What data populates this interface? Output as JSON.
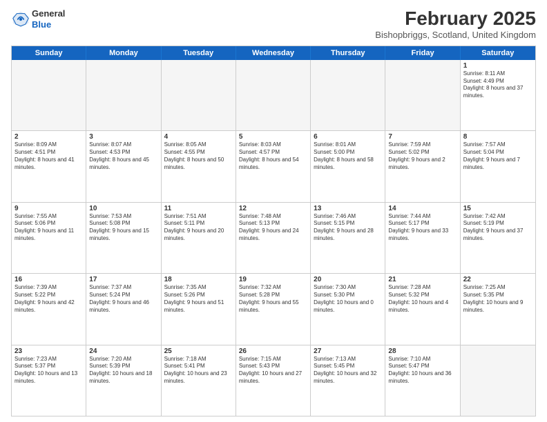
{
  "logo": {
    "general": "General",
    "blue": "Blue"
  },
  "title": "February 2025",
  "location": "Bishopbriggs, Scotland, United Kingdom",
  "days_of_week": [
    "Sunday",
    "Monday",
    "Tuesday",
    "Wednesday",
    "Thursday",
    "Friday",
    "Saturday"
  ],
  "weeks": [
    [
      {
        "day": "",
        "text": "",
        "empty": true
      },
      {
        "day": "",
        "text": "",
        "empty": true
      },
      {
        "day": "",
        "text": "",
        "empty": true
      },
      {
        "day": "",
        "text": "",
        "empty": true
      },
      {
        "day": "",
        "text": "",
        "empty": true
      },
      {
        "day": "",
        "text": "",
        "empty": true
      },
      {
        "day": "1",
        "text": "Sunrise: 8:11 AM\nSunset: 4:49 PM\nDaylight: 8 hours and 37 minutes."
      }
    ],
    [
      {
        "day": "2",
        "text": "Sunrise: 8:09 AM\nSunset: 4:51 PM\nDaylight: 8 hours and 41 minutes."
      },
      {
        "day": "3",
        "text": "Sunrise: 8:07 AM\nSunset: 4:53 PM\nDaylight: 8 hours and 45 minutes."
      },
      {
        "day": "4",
        "text": "Sunrise: 8:05 AM\nSunset: 4:55 PM\nDaylight: 8 hours and 50 minutes."
      },
      {
        "day": "5",
        "text": "Sunrise: 8:03 AM\nSunset: 4:57 PM\nDaylight: 8 hours and 54 minutes."
      },
      {
        "day": "6",
        "text": "Sunrise: 8:01 AM\nSunset: 5:00 PM\nDaylight: 8 hours and 58 minutes."
      },
      {
        "day": "7",
        "text": "Sunrise: 7:59 AM\nSunset: 5:02 PM\nDaylight: 9 hours and 2 minutes."
      },
      {
        "day": "8",
        "text": "Sunrise: 7:57 AM\nSunset: 5:04 PM\nDaylight: 9 hours and 7 minutes."
      }
    ],
    [
      {
        "day": "9",
        "text": "Sunrise: 7:55 AM\nSunset: 5:06 PM\nDaylight: 9 hours and 11 minutes."
      },
      {
        "day": "10",
        "text": "Sunrise: 7:53 AM\nSunset: 5:08 PM\nDaylight: 9 hours and 15 minutes."
      },
      {
        "day": "11",
        "text": "Sunrise: 7:51 AM\nSunset: 5:11 PM\nDaylight: 9 hours and 20 minutes."
      },
      {
        "day": "12",
        "text": "Sunrise: 7:48 AM\nSunset: 5:13 PM\nDaylight: 9 hours and 24 minutes."
      },
      {
        "day": "13",
        "text": "Sunrise: 7:46 AM\nSunset: 5:15 PM\nDaylight: 9 hours and 28 minutes."
      },
      {
        "day": "14",
        "text": "Sunrise: 7:44 AM\nSunset: 5:17 PM\nDaylight: 9 hours and 33 minutes."
      },
      {
        "day": "15",
        "text": "Sunrise: 7:42 AM\nSunset: 5:19 PM\nDaylight: 9 hours and 37 minutes."
      }
    ],
    [
      {
        "day": "16",
        "text": "Sunrise: 7:39 AM\nSunset: 5:22 PM\nDaylight: 9 hours and 42 minutes."
      },
      {
        "day": "17",
        "text": "Sunrise: 7:37 AM\nSunset: 5:24 PM\nDaylight: 9 hours and 46 minutes."
      },
      {
        "day": "18",
        "text": "Sunrise: 7:35 AM\nSunset: 5:26 PM\nDaylight: 9 hours and 51 minutes."
      },
      {
        "day": "19",
        "text": "Sunrise: 7:32 AM\nSunset: 5:28 PM\nDaylight: 9 hours and 55 minutes."
      },
      {
        "day": "20",
        "text": "Sunrise: 7:30 AM\nSunset: 5:30 PM\nDaylight: 10 hours and 0 minutes."
      },
      {
        "day": "21",
        "text": "Sunrise: 7:28 AM\nSunset: 5:32 PM\nDaylight: 10 hours and 4 minutes."
      },
      {
        "day": "22",
        "text": "Sunrise: 7:25 AM\nSunset: 5:35 PM\nDaylight: 10 hours and 9 minutes."
      }
    ],
    [
      {
        "day": "23",
        "text": "Sunrise: 7:23 AM\nSunset: 5:37 PM\nDaylight: 10 hours and 13 minutes."
      },
      {
        "day": "24",
        "text": "Sunrise: 7:20 AM\nSunset: 5:39 PM\nDaylight: 10 hours and 18 minutes."
      },
      {
        "day": "25",
        "text": "Sunrise: 7:18 AM\nSunset: 5:41 PM\nDaylight: 10 hours and 23 minutes."
      },
      {
        "day": "26",
        "text": "Sunrise: 7:15 AM\nSunset: 5:43 PM\nDaylight: 10 hours and 27 minutes."
      },
      {
        "day": "27",
        "text": "Sunrise: 7:13 AM\nSunset: 5:45 PM\nDaylight: 10 hours and 32 minutes."
      },
      {
        "day": "28",
        "text": "Sunrise: 7:10 AM\nSunset: 5:47 PM\nDaylight: 10 hours and 36 minutes."
      },
      {
        "day": "",
        "text": "",
        "empty": true
      }
    ]
  ]
}
